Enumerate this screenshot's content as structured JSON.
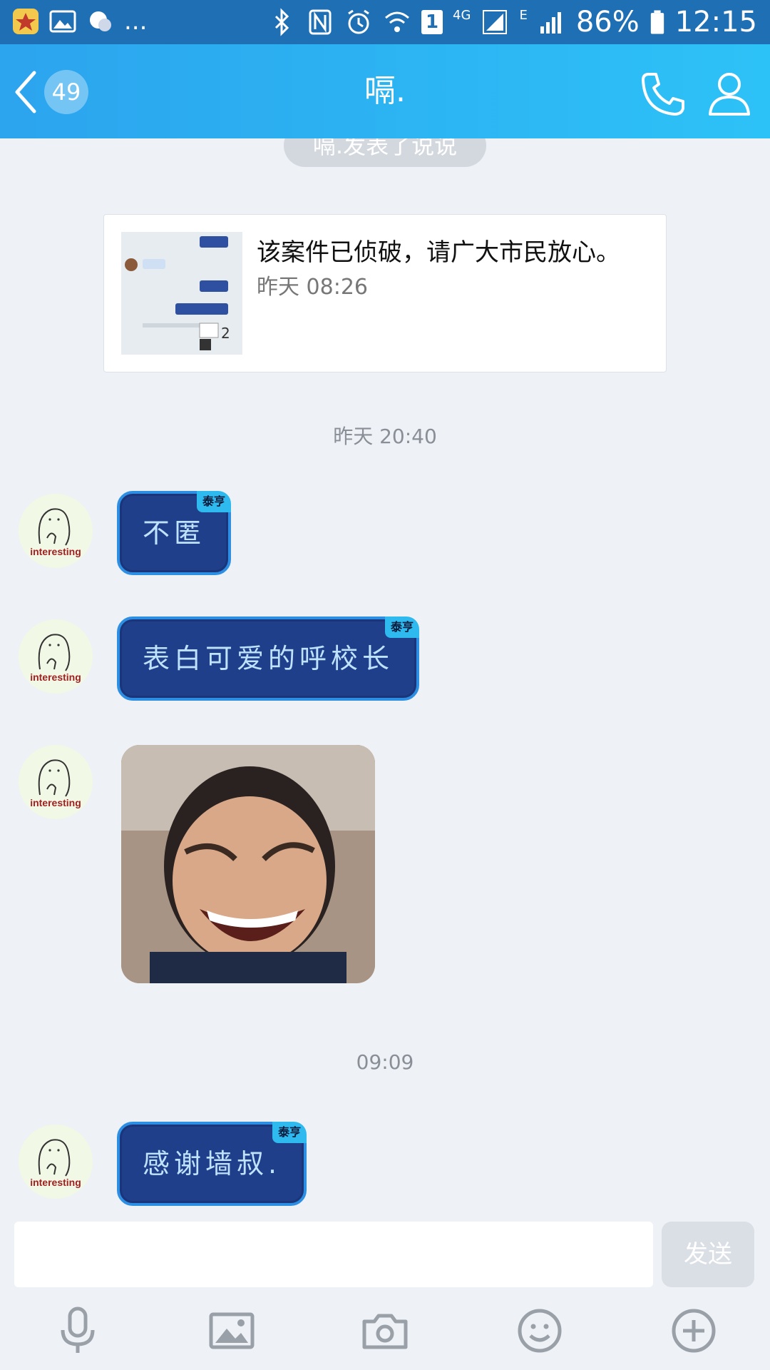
{
  "status_bar": {
    "left_icons": [
      "app-star-icon",
      "gallery-icon",
      "weather-icon"
    ],
    "more": "...",
    "sim_slot": "1",
    "network": "4G",
    "network2": "E",
    "battery": "86%",
    "time": "12:15"
  },
  "header": {
    "unread_count": "49",
    "title": "嗝.",
    "accent_color": "#2cb2f4"
  },
  "chat": {
    "system_notice": "嗝.发表了说说",
    "share_card": {
      "text": "该案件已侦破，请广大市民放心。",
      "time": "昨天 08:26",
      "image_count": "2"
    },
    "timestamps": [
      "昨天 20:40",
      "09:09"
    ],
    "messages": [
      {
        "text": "不匿",
        "tag": "泰亨"
      },
      {
        "text": "表白可爱的呼校长",
        "tag": "泰亨"
      },
      {
        "type": "image",
        "desc_icon": "meme-image"
      },
      {
        "text": "感谢墙叔.",
        "tag": "泰亨"
      }
    ],
    "avatar_label": "interesting"
  },
  "input": {
    "placeholder": "",
    "send_label": "发送"
  },
  "toolbar": {
    "icons": [
      "microphone-icon",
      "image-icon",
      "camera-icon",
      "emoji-icon",
      "plus-icon"
    ]
  }
}
